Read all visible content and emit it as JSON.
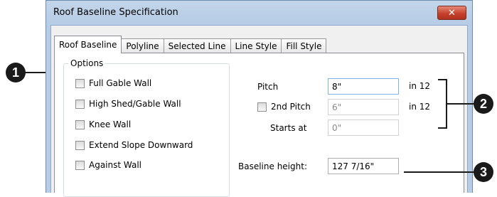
{
  "window": {
    "title": "Roof Baseline Specification",
    "close_glyph": "✕"
  },
  "tabs": [
    {
      "label": "Roof Baseline",
      "active": true
    },
    {
      "label": "Polyline",
      "active": false
    },
    {
      "label": "Selected Line",
      "active": false
    },
    {
      "label": "Line Style",
      "active": false
    },
    {
      "label": "Fill Style",
      "active": false
    }
  ],
  "options": {
    "legend": "Options",
    "items": [
      {
        "label": "Full Gable Wall",
        "checked": false
      },
      {
        "label": "High Shed/Gable Wall",
        "checked": false
      },
      {
        "label": "Knee Wall",
        "checked": false
      },
      {
        "label": "Extend Slope Downward",
        "checked": false
      },
      {
        "label": "Against Wall",
        "checked": false
      }
    ]
  },
  "pitch": {
    "label": "Pitch",
    "value": "8\"",
    "unit": "in 12"
  },
  "second_pitch": {
    "label": "2nd Pitch",
    "value": "6\"",
    "unit": "in 12",
    "checked": false
  },
  "starts_at": {
    "label": "Starts at",
    "value": "0\""
  },
  "baseline_height": {
    "label": "Baseline height:",
    "value": "127 7/16\""
  },
  "callouts": [
    "1",
    "2",
    "3"
  ]
}
